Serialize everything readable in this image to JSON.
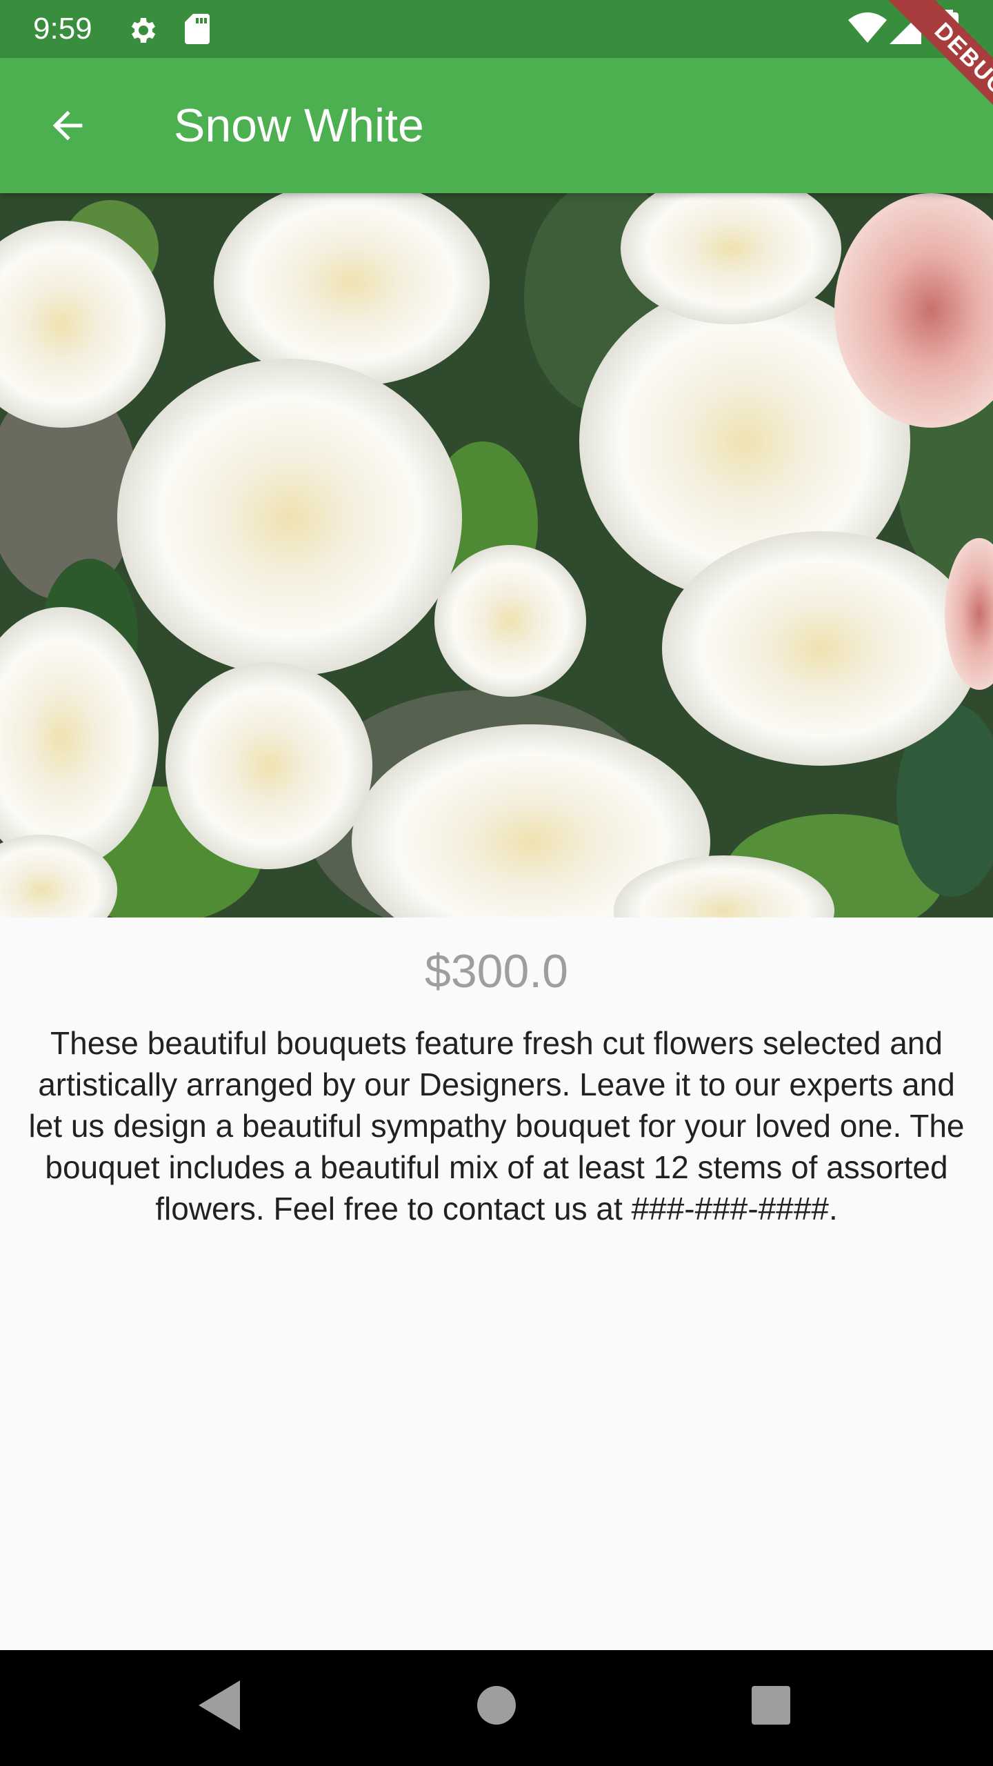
{
  "status_bar": {
    "time": "9:59",
    "icons": [
      "gear-icon",
      "sd-card-icon",
      "wifi-icon",
      "signal-icon",
      "battery-icon"
    ]
  },
  "app_bar": {
    "title": "Snow White",
    "back_icon": "arrow-back-icon",
    "color": "#4caf50"
  },
  "debug_banner": {
    "label": "DEBUG"
  },
  "product": {
    "image_icon": "flower-bouquet-image",
    "price": "$300.0",
    "description": "These beautiful bouquets feature fresh cut flowers selected and artistically arranged by our Designers. Leave it to our experts and let us design a beautiful sympathy bouquet for your loved one. The bouquet includes a beautiful mix of at least 12 stems of assorted flowers. Feel free to contact us at ###-###-####."
  },
  "nav_bar": {
    "icons": [
      "nav-back-icon",
      "nav-home-icon",
      "nav-recents-icon"
    ]
  },
  "colors": {
    "status_bar": "#388e3c",
    "app_bar": "#4caf50",
    "price": "#9e9e9e",
    "background": "#fafafa"
  }
}
